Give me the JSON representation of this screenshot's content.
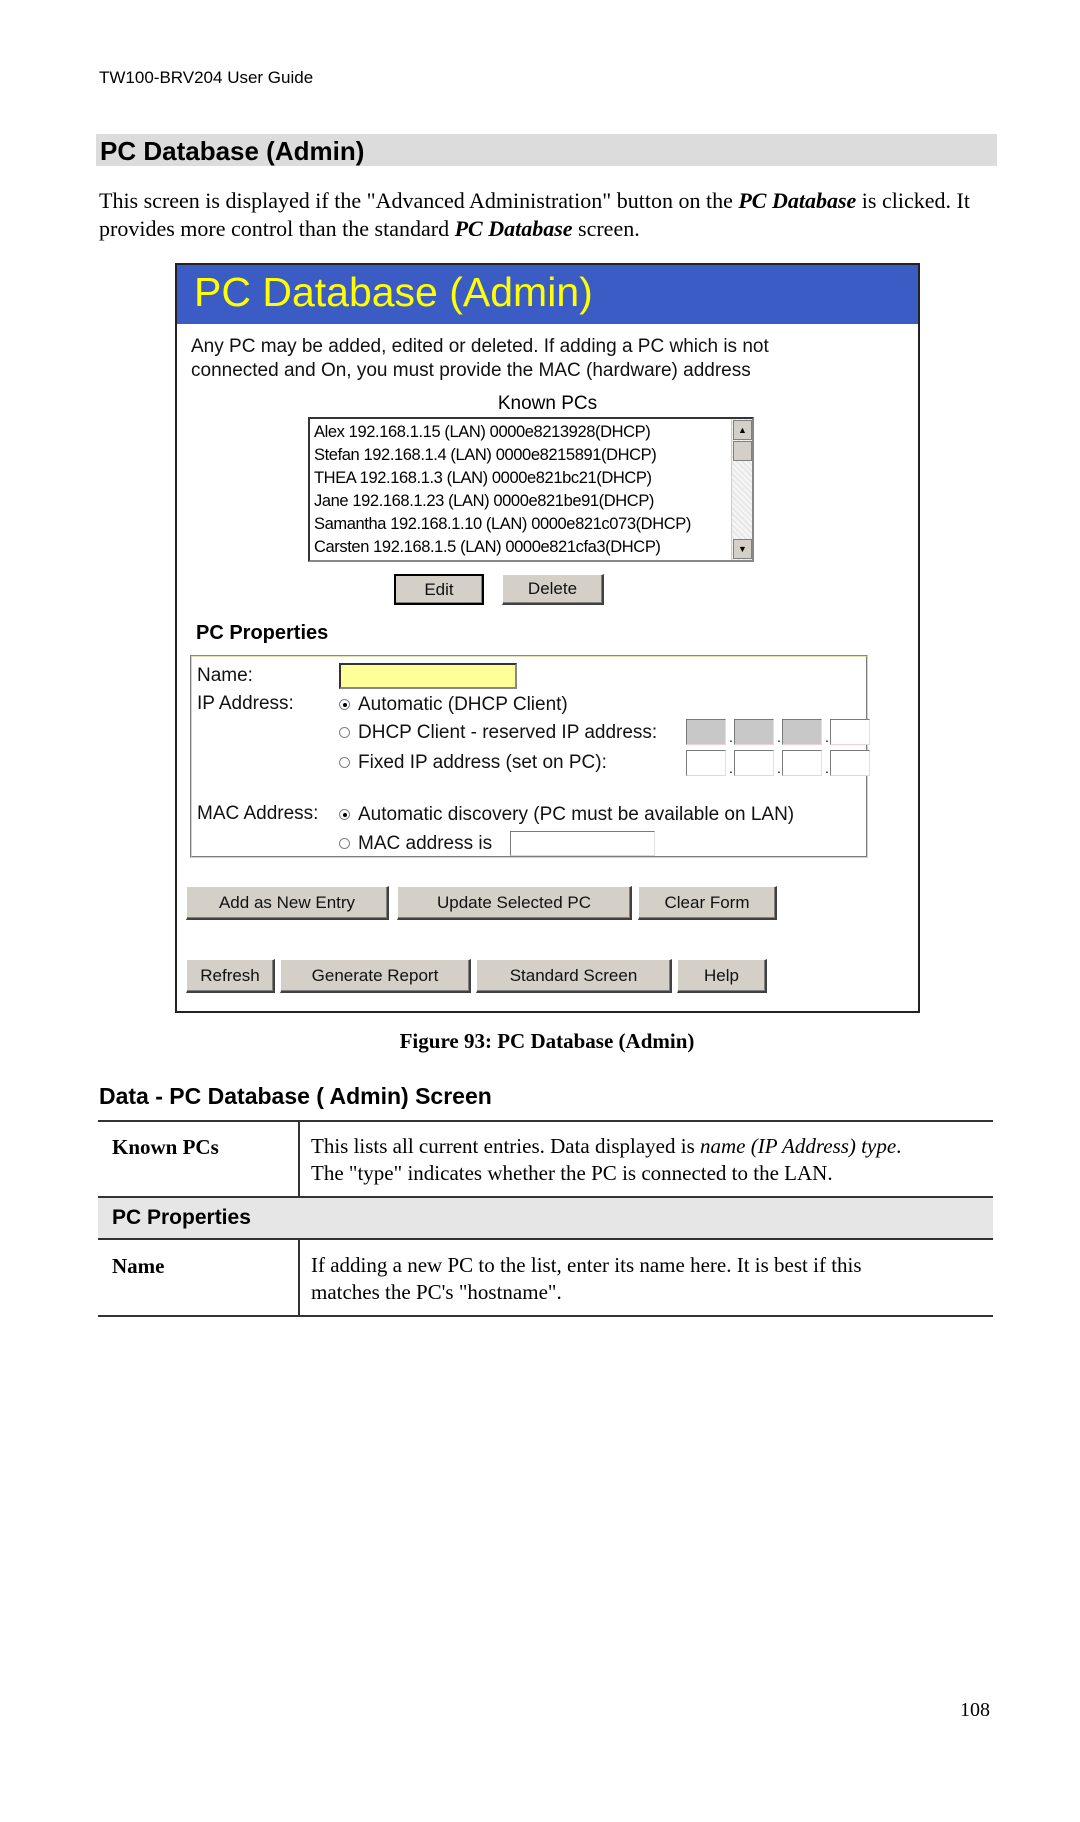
{
  "running_header": "TW100-BRV204 User Guide",
  "section_title": "PC Database (Admin)",
  "intro": {
    "part1": "This screen is displayed if the \"Advanced Administration\" button on the ",
    "emph1": "PC Database",
    "part2": " is clicked. It provides more control than the standard ",
    "emph2": "PC Database",
    "part3": " screen."
  },
  "window": {
    "title": "PC Database (Admin)",
    "title_bg": "#3b5cc4",
    "title_color": "#ffff00",
    "description_line1": "Any PC may be added, edited or deleted. If adding a PC which is not",
    "description_line2": "connected and On, you must provide the MAC (hardware) address",
    "known_pcs_label": "Known PCs",
    "known_pcs": [
      "Alex 192.168.1.15 (LAN) 0000e8213928(DHCP)",
      "Stefan 192.168.1.4 (LAN) 0000e8215891(DHCP)",
      "THEA 192.168.1.3 (LAN) 0000e821bc21(DHCP)",
      "Jane 192.168.1.23 (LAN) 0000e821be91(DHCP)",
      "Samantha 192.168.1.10 (LAN) 0000e821c073(DHCP)",
      "Carsten 192.168.1.5 (LAN) 0000e821cfa3(DHCP)"
    ],
    "edit_button": "Edit",
    "delete_button": "Delete",
    "pc_properties_title": "PC Properties",
    "name_label": "Name:",
    "name_value": "",
    "ip_label": "IP Address:",
    "ip_options": [
      {
        "label": "Automatic (DHCP Client)",
        "selected": true
      },
      {
        "label": "DHCP Client - reserved IP address:",
        "selected": false
      },
      {
        "label": "Fixed IP address (set on PC):",
        "selected": false
      }
    ],
    "reserved_ip": [
      "",
      "",
      "",
      ""
    ],
    "fixed_ip": [
      "",
      "",
      "",
      ""
    ],
    "mac_label": "MAC Address:",
    "mac_options": [
      {
        "label": "Automatic discovery (PC must be available on LAN)",
        "selected": true
      },
      {
        "label": "MAC address is",
        "selected": false
      }
    ],
    "mac_value": "",
    "action_buttons": [
      "Add as New Entry",
      "Update Selected PC",
      "Clear Form"
    ],
    "nav_buttons": [
      "Refresh",
      "Generate Report",
      "Standard Screen",
      "Help"
    ]
  },
  "figure_caption": "Figure 93: PC Database (Admin)",
  "data_heading": "Data - PC Database ( Admin) Screen",
  "table": {
    "known_pcs": {
      "label": "Known PCs",
      "desc_part1": "This lists all current entries. Data displayed is ",
      "desc_emph": "name (IP Address) type",
      "desc_part2": ".",
      "desc_line2": "The \"type\" indicates whether the PC is connected to the LAN."
    },
    "section_row": "PC Properties",
    "name": {
      "label": "Name",
      "desc_line1": "If adding a new PC to the list, enter its name here. It is best if this",
      "desc_line2": "matches the PC's \"hostname\"."
    }
  },
  "page_number": "108"
}
